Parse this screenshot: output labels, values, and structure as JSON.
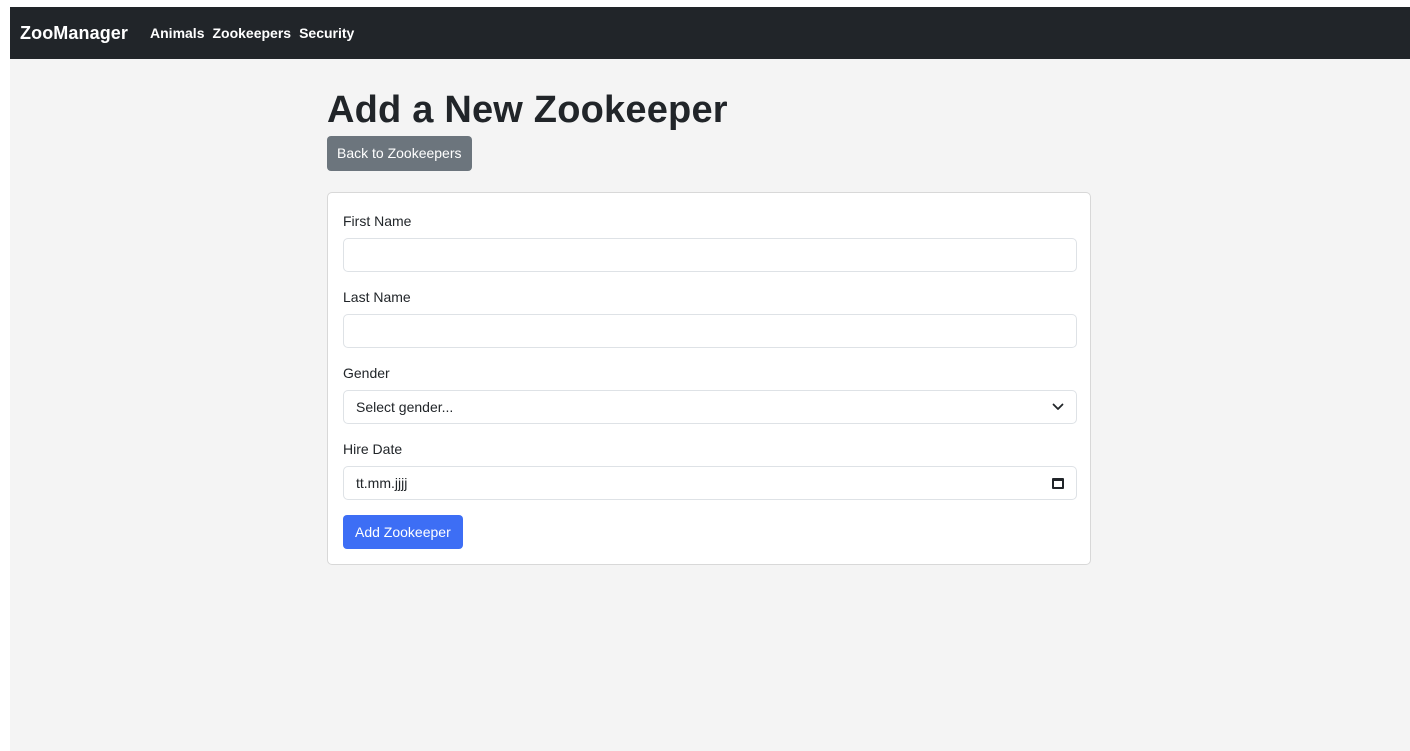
{
  "navbar": {
    "brand": "ZooManager",
    "links": [
      "Animals",
      "Zookeepers",
      "Security"
    ]
  },
  "page_title": "Add a New Zookeeper",
  "back_button": "Back to Zookeepers",
  "form": {
    "first_name_label": "First Name",
    "first_name_value": "",
    "last_name_label": "Last Name",
    "last_name_value": "",
    "gender_label": "Gender",
    "gender_selected": "Select gender...",
    "hire_date_label": "Hire Date",
    "hire_date_placeholder": "tt.mm.jjjj",
    "submit_label": "Add Zookeeper"
  },
  "icons": {
    "gender_dropdown": "chevron-down-icon",
    "hire_date_picker": "calendar-icon"
  },
  "colors": {
    "navbar": "#212529",
    "back_button": "#6c757d",
    "submit_button": "#3d6ef5",
    "page_background": "#f4f4f4"
  }
}
